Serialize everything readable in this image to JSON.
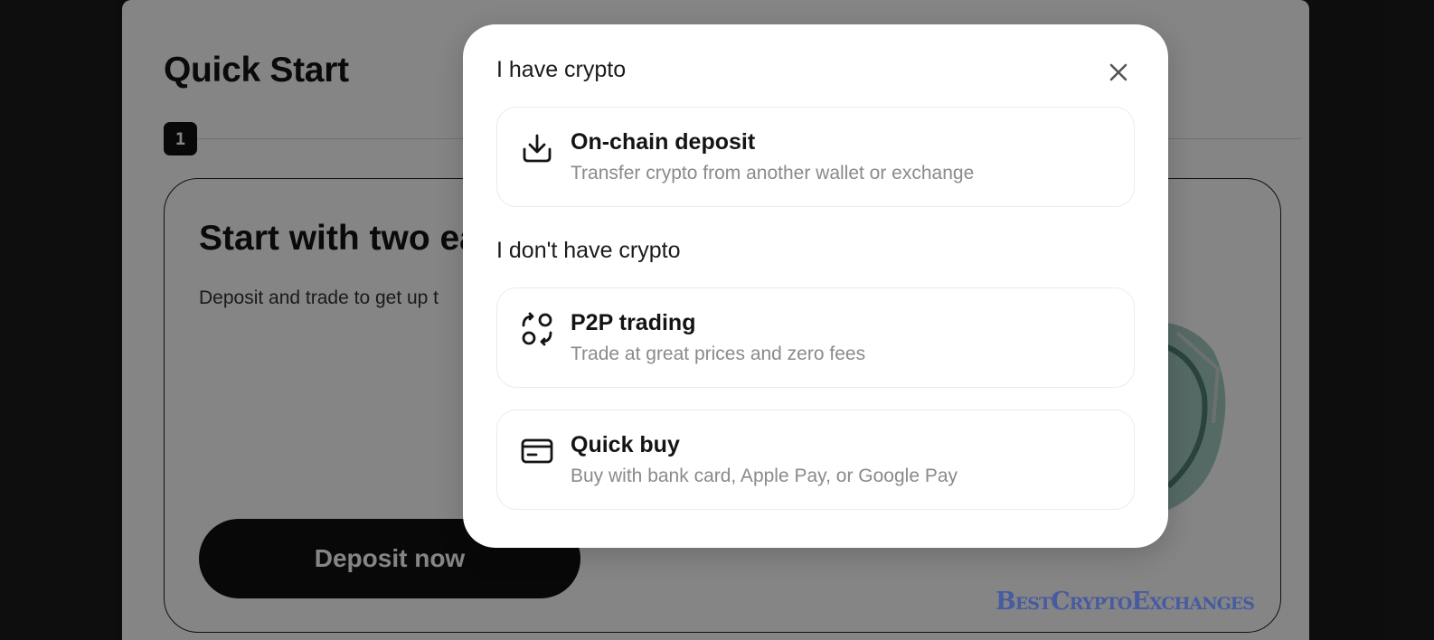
{
  "background": {
    "page_title": "Quick Start",
    "step_number": "1",
    "promo_title": "Start with two ea",
    "promo_subtitle": "Deposit and trade to get up t",
    "deposit_button": "Deposit now"
  },
  "modal": {
    "section_have": "I have crypto",
    "section_dont_have": "I don't have crypto",
    "close_icon": "close-icon",
    "options": [
      {
        "icon": "download-icon",
        "title": "On-chain deposit",
        "description": "Transfer crypto from another wallet or exchange"
      },
      {
        "icon": "p2p-exchange-icon",
        "title": "P2P trading",
        "description": "Trade at great prices and zero fees"
      },
      {
        "icon": "credit-card-icon",
        "title": "Quick buy",
        "description": "Buy with bank card, Apple Pay, or Google Pay"
      }
    ]
  },
  "watermark": "BestCryptoExchanges",
  "colors": {
    "overlay": "rgba(0,0,0,0.48)",
    "primary": "#111111",
    "muted_text": "#8a8a8a",
    "watermark": "#3d55a5"
  }
}
